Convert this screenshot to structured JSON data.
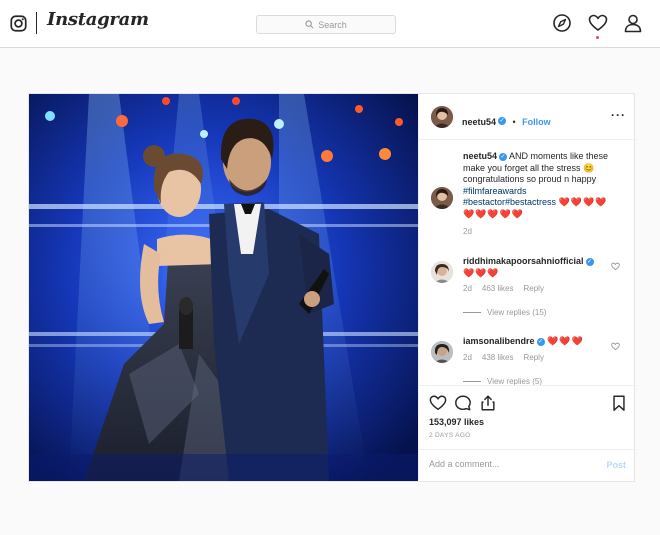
{
  "nav": {
    "wordmark": "Instagram",
    "search_placeholder": "Search",
    "accent": "#3897f0",
    "notification_color": "#ed4956",
    "icons": [
      "instagram-camera-icon",
      "search-icon",
      "explore-compass-icon",
      "activity-heart-icon",
      "profile-icon"
    ]
  },
  "post": {
    "author": "neetu54",
    "follow_separator": "•",
    "follow_label": "Follow",
    "photo_description_icon": "couple-photo",
    "caption": {
      "user": "neetu54",
      "text": "AND moments like these make you forget all the stress 😊 congratulations so proud n happy",
      "tags": [
        "#filmfareawards",
        "#bestactor",
        "#bestactress"
      ],
      "hearts_line1": "❤️❤️❤️❤️",
      "hearts_line2": "❤️❤️❤️❤️❤️",
      "time": "2d"
    },
    "comments": [
      {
        "user": "riddhimakapoorsahniofficial",
        "text": "❤️❤️❤️",
        "time": "2d",
        "likes": "463 likes",
        "reply_label": "Reply",
        "view_replies": "View replies (15)"
      },
      {
        "user": "iamsonalibendre",
        "text": "❤️❤️❤️",
        "time": "2d",
        "likes": "438 likes",
        "reply_label": "Reply",
        "view_replies": "View replies (5)"
      }
    ],
    "likes": "153,097 likes",
    "posted_ago": "2 DAYS AGO",
    "add_comment_placeholder": "Add a comment...",
    "post_button": "Post"
  }
}
